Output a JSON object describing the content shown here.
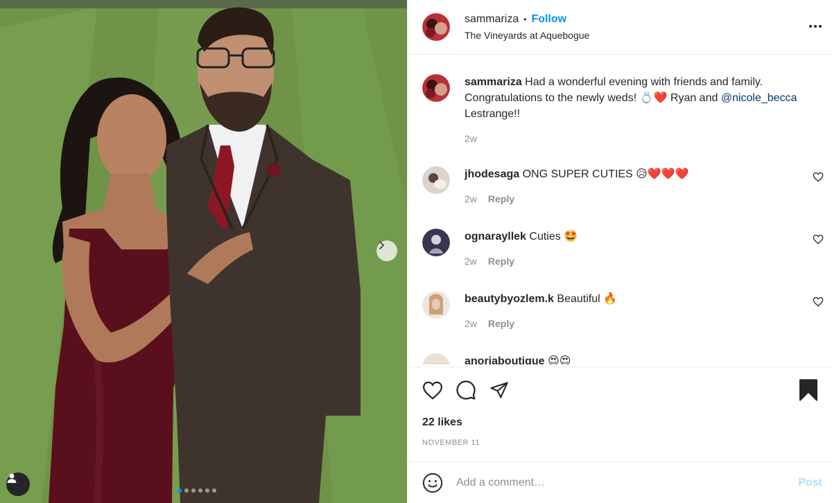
{
  "post": {
    "author": "sammariza",
    "follow_label": "Follow",
    "location": "The Vineyards at Aquebogue",
    "caption_text": "Had a wonderful evening with friends and family. Congratulations to the newly weds! ",
    "caption_emoji": "💍❤️",
    "caption_text2": " Ryan and ",
    "caption_mention": "@nicole_becca",
    "caption_text3": " Lestrange!!",
    "caption_time": "2w",
    "likes_count": "22",
    "likes_label": "likes",
    "date": "NOVEMBER 11"
  },
  "comments": [
    {
      "user": "jhodesaga",
      "text": "ONG SUPER CUTIES ",
      "emoji": "😥❤️❤️❤️",
      "time": "2w",
      "reply": "Reply"
    },
    {
      "user": "ognarayllek",
      "text": "Cuties ",
      "emoji": "🤩",
      "time": "2w",
      "reply": "Reply"
    },
    {
      "user": "beautybyozlem.k",
      "text": "Beautiful ",
      "emoji": "🔥",
      "time": "2w",
      "reply": "Reply"
    },
    {
      "user": "anoriaboutique",
      "text": "",
      "emoji": "😍😍",
      "time": "",
      "reply": ""
    }
  ],
  "composer": {
    "placeholder": "Add a comment…",
    "post_label": "Post"
  },
  "carousel": {
    "total": 6,
    "active_index": 0
  },
  "colors": {
    "accent": "#0095f6",
    "mention": "#00376b",
    "muted": "#8e8e8e",
    "post_disabled": "#b2dffc"
  }
}
